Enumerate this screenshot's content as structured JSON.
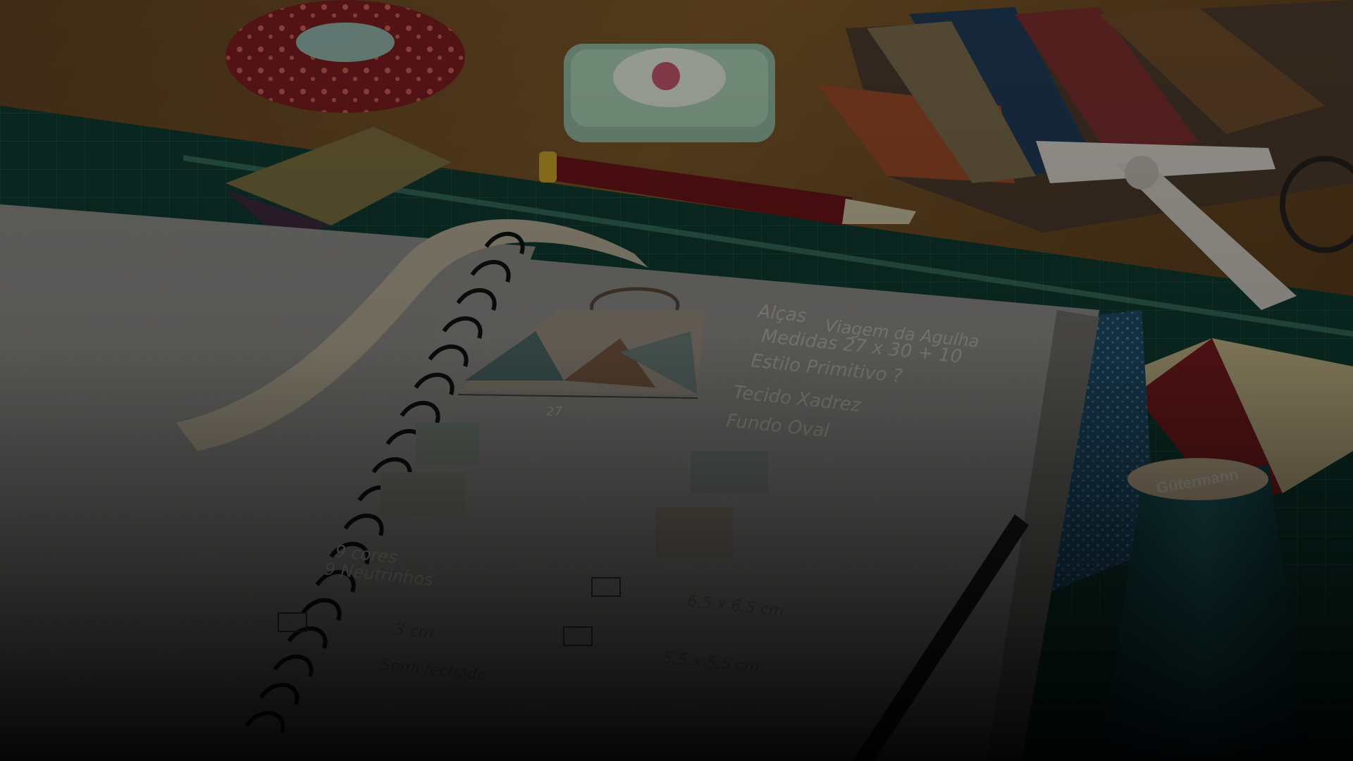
{
  "photo": {
    "subject": "",
    "notebook": {
      "notes": {
        "line1": "Alças",
        "line2": "Viagem da Agulha",
        "line3": "Medidas  27 x 30 + 10",
        "line4": "Estilo Primitivo ?",
        "line5": "Tecido Xadrez",
        "line6": "Fundo Oval",
        "width_label": "27",
        "cores": "9 cores",
        "neutrinhos": "9 Neutrinhos",
        "size1": "6,5 x 6,5 cm",
        "size2": "3 cm",
        "size3": "5,5 x 5,5 cm",
        "extra": "Semi fechado"
      }
    },
    "thread_spool_brand": "Gütermann",
    "colors": {
      "wood_table": "#6b4a22",
      "cutting_mat": "#0f3a30",
      "paper": "#8d8c88",
      "grid_line": "#7f9a98"
    }
  }
}
